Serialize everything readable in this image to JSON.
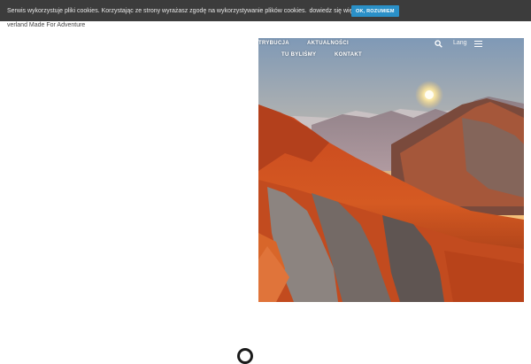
{
  "cookie_bar": {
    "message": "Serwis wykorzystuje pliki cookies. Korzystając ze strony wyrażasz zgodę na wykorzystywanie plików cookies.",
    "more_link": "dowiedz się więcej.",
    "accept_label": "OK, ROZUMIEM"
  },
  "site": {
    "tagline": "verland Made For Adventure"
  },
  "nav": {
    "items": [
      "TRYBUCJA",
      "AKTUALNOŚCI",
      "TU BYLIŚMY",
      "KONTAKT"
    ],
    "lang_label": "Lang"
  },
  "colors": {
    "cookie_bg": "#3c3c3c",
    "accent": "#2a90c8"
  }
}
